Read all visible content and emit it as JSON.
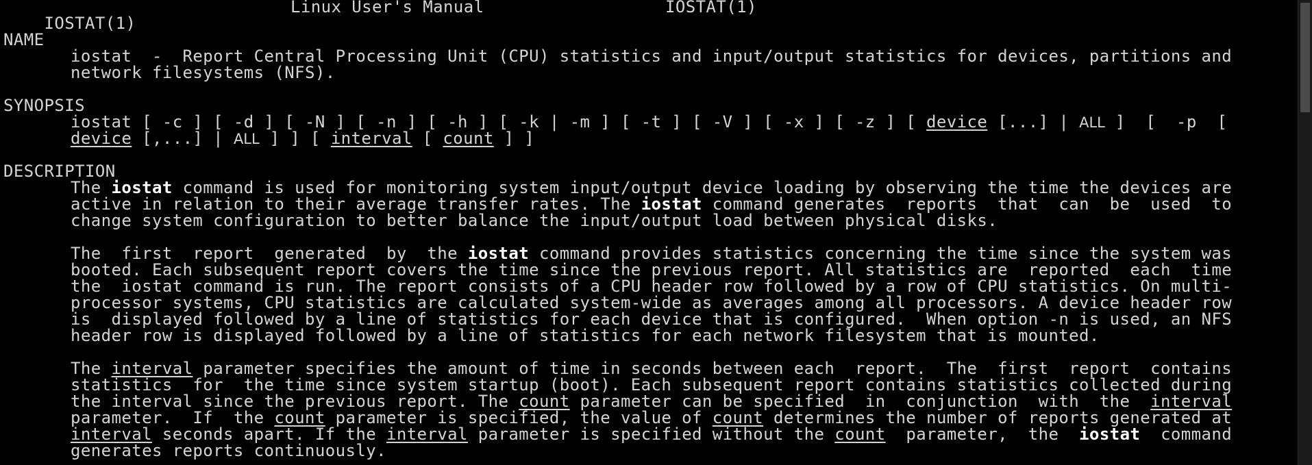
{
  "header": {
    "left": "IOSTAT(1)",
    "center": "Linux User's Manual",
    "right": "IOSTAT(1)"
  },
  "name": {
    "heading": "NAME",
    "line1": "iostat  -  Report Central Processing Unit (CPU) statistics and input/output statistics for devices, partitions and",
    "line2": "network filesystems (NFS)."
  },
  "synopsis": {
    "heading": "SYNOPSIS",
    "l1_cmd": "iostat",
    "l1_opts": "[ -c ] [ -d ] [ -N ] [ -n ] [ -h ] [ -k | -m ] [ -t ] [ -V ] [ -x ] [ -z ] [",
    "l1_device": "device",
    "l1_more": "[...] |",
    "l1_all": "ALL",
    "l1_close": "]",
    "l1_p": "[  -p  [",
    "l2_device": "device",
    "l2_more": "[,...] |",
    "l2_all": "ALL",
    "l2_close": "] ] [",
    "l2_interval": "interval",
    "l2_bracket": "[",
    "l2_count": "count",
    "l2_end": "] ]"
  },
  "description": {
    "heading": "DESCRIPTION",
    "p1": {
      "l1a": "The ",
      "l1b": "iostat",
      "l1c": " command is used for monitoring system input/output device loading by observing the time the devices are",
      "l2a": "active in relation to their average transfer rates. The ",
      "l2b": "iostat",
      "l2c": " command generates  reports  that  can  be  used  to",
      "l3": "change system configuration to better balance the input/output load between physical disks."
    },
    "p2": {
      "l1a": "The  first  report  generated  by  the ",
      "l1b": "iostat",
      "l1c": " command provides statistics concerning the time since the system was",
      "l2": "booted. Each subsequent report covers the time since the previous report. All statistics are  reported  each  time",
      "l3": "the  iostat command is run. The report consists of a CPU header row followed by a row of CPU statistics. On multi-",
      "l4": "processor systems, CPU statistics are calculated system-wide as averages among all processors. A device header row",
      "l5": "is  displayed followed by a line of statistics for each device that is configured.  When option -n is used, an NFS",
      "l6": "header row is displayed followed by a line of statistics for each network filesystem that is mounted."
    },
    "p3": {
      "l1a": "The ",
      "l1b": "interval",
      "l1c": " parameter specifies the amount of time in seconds between each  report.  The  first  report  contains",
      "l2": "statistics  for  the time since system startup (boot). Each subsequent report contains statistics collected during",
      "l3a": "the interval since the previous report. The ",
      "l3b": "count",
      "l3c": " parameter can be specified  in  conjunction  with  the  ",
      "l3d": "interval",
      "l4a": "parameter.  If  the ",
      "l4b": "count",
      "l4c": " parameter is specified, the value of ",
      "l4d": "count",
      "l4e": " determines the number of reports generated at",
      "l5a": "interval",
      "l5b": " seconds apart. If the ",
      "l5c": "interval",
      "l5d": " parameter is specified without the ",
      "l5e": "count",
      "l5f": "  parameter,  the  ",
      "l5g": "iostat",
      "l5h": "  command",
      "l6": "generates reports continuously."
    }
  },
  "colors": {
    "background": "#000000",
    "text": "#d4d4d4",
    "bold": "#ffffff"
  }
}
